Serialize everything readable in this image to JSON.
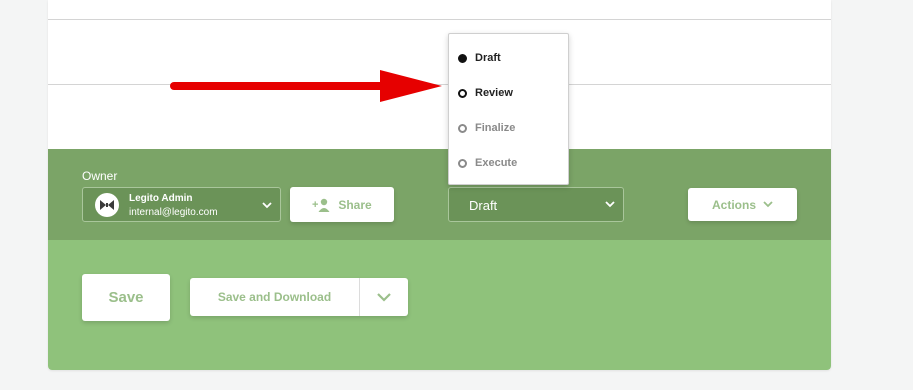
{
  "owner": {
    "label": "Owner",
    "name": "Legito Admin",
    "email": "internal@legito.com"
  },
  "share_button": {
    "label": "Share"
  },
  "status": {
    "selected": "Draft",
    "options": [
      "Draft",
      "Review",
      "Finalize",
      "Execute"
    ]
  },
  "actions_button": {
    "label": "Actions"
  },
  "footer": {
    "save_label": "Save",
    "save_download_label": "Save and Download"
  },
  "colors": {
    "owner_band": "#7ba467",
    "action_band": "#8fc27b",
    "button_text": "#9bbf8b",
    "arrow": "#e60000"
  },
  "icons": [
    "avatar-logo-icon",
    "chevron-down-icon",
    "add-user-icon",
    "radio-icon",
    "red-arrow-annotation"
  ]
}
